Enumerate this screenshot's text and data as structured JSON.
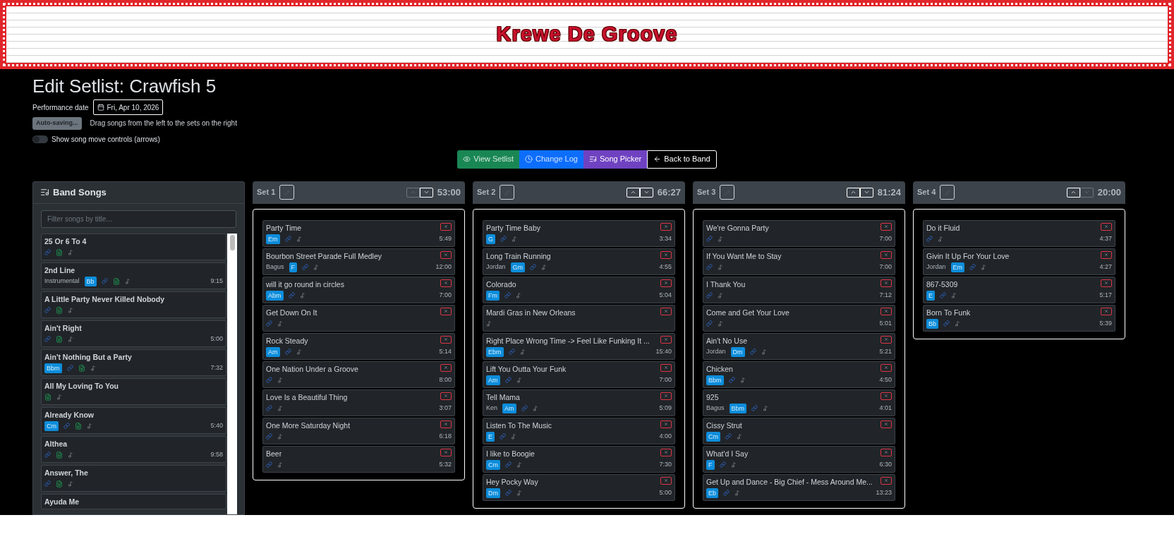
{
  "banner": {
    "title": "Krewe De Groove"
  },
  "page": {
    "title": "Edit Setlist: Crawfish 5"
  },
  "performance_date": {
    "label": "Performance date",
    "value": "Fri, Apr 10, 2026"
  },
  "status": {
    "badge": "Auto-saving...",
    "hint": "Drag songs from the left to the sets on the right"
  },
  "move_controls_toggle": {
    "label": "Show song move controls (arrows)",
    "on": false
  },
  "nav_buttons": [
    {
      "label": "View Setlist",
      "kind": "view"
    },
    {
      "label": "Change Log",
      "kind": "log"
    },
    {
      "label": "Song Picker",
      "kind": "picker"
    },
    {
      "label": "Back to Band",
      "kind": "back"
    }
  ],
  "band_songs": {
    "title": "Band Songs",
    "filter": {
      "placeholder": "Filter songs by title..."
    },
    "songs": [
      {
        "title": "25 Or 6 To 4",
        "link": true,
        "chart": true
      },
      {
        "title": "2nd Line",
        "singer": "Instrumental",
        "key": "Bb",
        "link": true,
        "chart": true,
        "duration": "9:15"
      },
      {
        "title": "A Little Party Never Killed Nobody",
        "link": true,
        "chart": true
      },
      {
        "title": "Ain't Right",
        "link": true,
        "chart": true,
        "duration": "5:00"
      },
      {
        "title": "Ain't Nothing But a Party",
        "key": "Bbm",
        "link": true,
        "chart": true,
        "duration": "7:32"
      },
      {
        "title": "All My Loving To You",
        "link": false,
        "chart": true
      },
      {
        "title": "Already Know",
        "key": "Cm",
        "link": true,
        "chart": true,
        "duration": "5:40"
      },
      {
        "title": "Althea",
        "link": true,
        "chart": true,
        "duration": "9:58"
      },
      {
        "title": "Answer, The",
        "link": true,
        "chart": true
      },
      {
        "title": "Ayuda Me"
      }
    ]
  },
  "sets": [
    {
      "name": "Set 1",
      "total": "53:00",
      "up_enabled": false,
      "down_enabled": true,
      "songs": [
        {
          "title": "Party Time",
          "key": "Em",
          "link": true,
          "duration": "5:49"
        },
        {
          "title": "Bourbon Street Parade Full Medley",
          "singer": "Bagus",
          "key": "F",
          "link": true,
          "duration": "12:00"
        },
        {
          "title": "will it go round in circles",
          "key": "Abm",
          "link": true,
          "duration": "7:00"
        },
        {
          "title": "Get Down On It",
          "link": true
        },
        {
          "title": "Rock Steady",
          "key": "Am",
          "link": true,
          "duration": "5:14"
        },
        {
          "title": "One Nation Under a Groove",
          "link": true,
          "duration": "8:00"
        },
        {
          "title": "Love Is a Beautiful Thing",
          "link": true,
          "duration": "3:07"
        },
        {
          "title": "One More Saturday Night",
          "link": true,
          "duration": "6:18"
        },
        {
          "title": "Beer",
          "link": true,
          "duration": "5:32"
        }
      ]
    },
    {
      "name": "Set 2",
      "total": "66:27",
      "up_enabled": true,
      "down_enabled": true,
      "songs": [
        {
          "title": "Party Time Baby",
          "key": "G",
          "link": true,
          "duration": "3:34"
        },
        {
          "title": "Long Train Running",
          "singer": "Jordan",
          "key": "Gm",
          "link": true,
          "duration": "4:55"
        },
        {
          "title": "Colorado",
          "key": "Fm",
          "link": true,
          "duration": "5:04"
        },
        {
          "title": "Mardi Gras in New Orleans",
          "link": false
        },
        {
          "title": "Right Place Wrong Time -> Feel Like Funking It ...",
          "key": "Ebm",
          "link": true,
          "duration": "15:40"
        },
        {
          "title": "Lift You Outta Your Funk",
          "key": "Am",
          "link": true,
          "duration": "7:00"
        },
        {
          "title": "Tell Mama",
          "singer": "Ken",
          "key": "Am",
          "link": true,
          "duration": "5:09"
        },
        {
          "title": "Listen To The Music",
          "key": "E",
          "link": true,
          "duration": "4:00"
        },
        {
          "title": "I like to Boogie",
          "key": "Cm",
          "link": true,
          "duration": "7:30"
        },
        {
          "title": "Hey Pocky Way",
          "key": "Dm",
          "link": true,
          "duration": "5:00"
        }
      ]
    },
    {
      "name": "Set 3",
      "total": "81:24",
      "up_enabled": true,
      "down_enabled": true,
      "songs": [
        {
          "title": "We're Gonna Party",
          "link": true,
          "duration": "7:00"
        },
        {
          "title": "If You Want Me to Stay",
          "link": true,
          "duration": "7:00"
        },
        {
          "title": "I Thank You",
          "link": true,
          "duration": "7:12"
        },
        {
          "title": "Come and Get Your Love",
          "link": true,
          "duration": "5:01"
        },
        {
          "title": "Ain't No Use",
          "singer": "Jordan",
          "key": "Dm",
          "link": true,
          "duration": "5:21"
        },
        {
          "title": "Chicken",
          "key": "Bbm",
          "link": true,
          "duration": "4:50"
        },
        {
          "title": "925",
          "singer": "Bagus",
          "key": "Bbm",
          "link": true,
          "duration": "4:01"
        },
        {
          "title": "Cissy Strut",
          "key": "Cm",
          "link": true
        },
        {
          "title": "What'd I Say",
          "key": "F",
          "link": true,
          "duration": "6:30"
        },
        {
          "title": "Get Up and Dance - Big Chief - Mess Around Me...",
          "key": "Eb",
          "link": true,
          "duration": "13:23"
        }
      ]
    },
    {
      "name": "Set 4",
      "total": "20:00",
      "up_enabled": true,
      "down_enabled": false,
      "songs": [
        {
          "title": "Do it Fluid",
          "link": true,
          "duration": "4:37"
        },
        {
          "title": "Givin It Up For Your Love",
          "singer": "Jordan",
          "key": "Em",
          "link": true,
          "duration": "4:27"
        },
        {
          "title": "867-5309",
          "key": "E",
          "link": true,
          "duration": "5:17"
        },
        {
          "title": "Born To Funk",
          "key": "Bb",
          "link": true,
          "duration": "5:39"
        }
      ]
    }
  ]
}
